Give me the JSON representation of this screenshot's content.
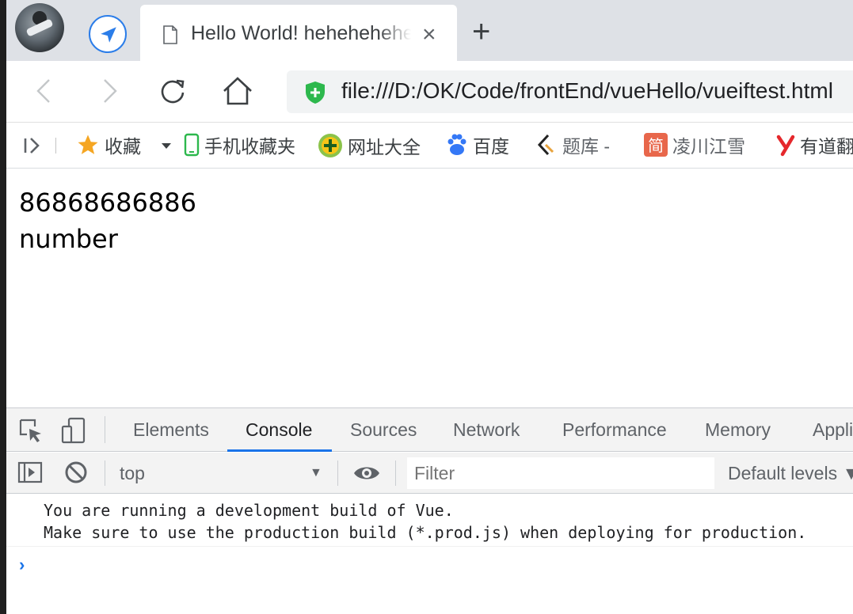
{
  "browser": {
    "tab": {
      "title": "Hello World! hehehehehe",
      "close": "×"
    },
    "new_tab": "+",
    "address": {
      "url": "file:///D:/OK/Code/frontEnd/vueHello/vueiftest.html"
    }
  },
  "bookmarks": [
    {
      "label": "收藏",
      "icon": "star-icon"
    },
    {
      "label": "手机收藏夹",
      "icon": "phone-icon"
    },
    {
      "label": "网址大全",
      "icon": "plus-circle-icon"
    },
    {
      "label": "百度",
      "icon": "baidu-paw-icon"
    },
    {
      "label": "题库 -",
      "icon": "tiku-icon"
    },
    {
      "label": "凌川江雪",
      "icon": "jian-icon"
    },
    {
      "label": "有道翻译",
      "icon": "youdao-icon"
    }
  ],
  "page": {
    "line1": "86868686886",
    "line2": "number"
  },
  "devtools": {
    "tabs": [
      "Elements",
      "Console",
      "Sources",
      "Network",
      "Performance",
      "Memory",
      "Application"
    ],
    "active_tab": "Console",
    "context": "top",
    "filter_placeholder": "Filter",
    "levels": "Default levels ▼",
    "messages": [
      "You are running a development build of Vue.",
      "Make sure to use the production build (*.prod.js) when deploying for production."
    ],
    "prompt": "›"
  },
  "colors": {
    "accent": "#1a73e8",
    "tab_bar": "#dee1e6",
    "devtools_bg": "#f3f3f3"
  }
}
